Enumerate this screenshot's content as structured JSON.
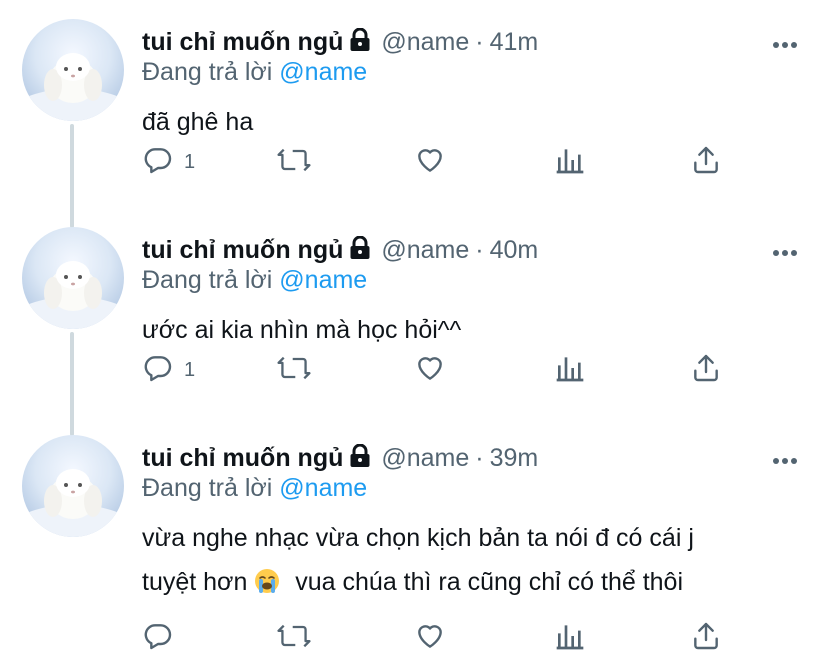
{
  "tweets": [
    {
      "display_name": "tui chỉ muốn ngủ",
      "handle": "@name",
      "separator": "·",
      "time": "41m",
      "replying_prefix": "Đang trả lời",
      "replying_to": "@name",
      "text_lines": [
        "đã ghê ha"
      ],
      "reply_count": "1"
    },
    {
      "display_name": "tui chỉ muốn ngủ",
      "handle": "@name",
      "separator": "·",
      "time": "40m",
      "replying_prefix": "Đang trả lời",
      "replying_to": "@name",
      "text_lines": [
        "ước ai kia nhìn mà học hỏi^^"
      ],
      "reply_count": "1"
    },
    {
      "display_name": "tui chỉ muốn ngủ",
      "handle": "@name",
      "separator": "·",
      "time": "39m",
      "replying_prefix": "Đang trả lời",
      "replying_to": "@name",
      "text_lines": [
        "vừa nghe nhạc vừa chọn kịch bản ta nói đ có cái j",
        "tuyệt hơn",
        "vua chúa thì ra cũng chỉ có thể thôi"
      ],
      "reply_count": ""
    }
  ],
  "icons": {
    "lock": "lock-icon",
    "more": "more-icon",
    "reply": "reply-icon",
    "retweet": "retweet-icon",
    "like": "heart-icon",
    "views": "analytics-icon",
    "share": "share-icon",
    "emoji": "loudly-crying-face-emoji"
  },
  "colors": {
    "link": "#1d9bf0",
    "secondary_text": "#536471",
    "thread_line": "#cfd9de"
  }
}
